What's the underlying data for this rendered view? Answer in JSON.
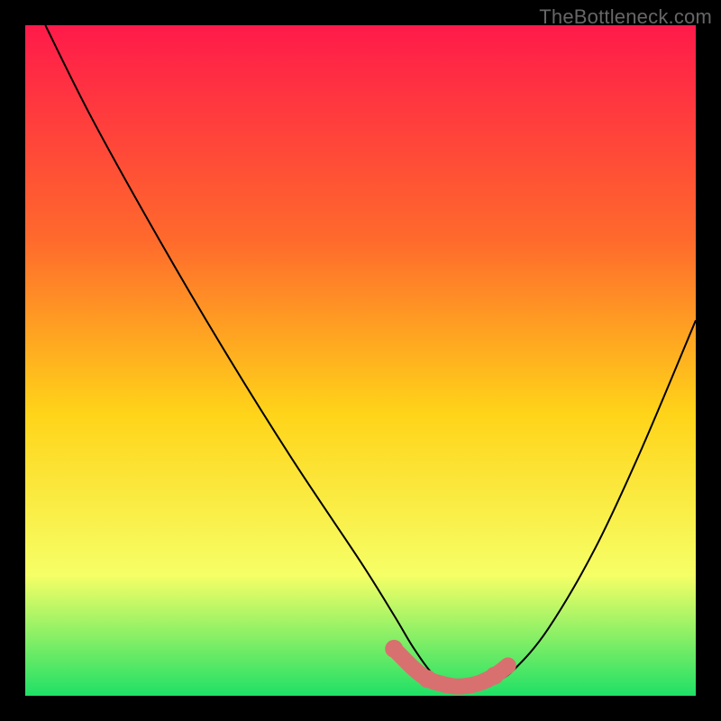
{
  "watermark": "TheBottleneck.com",
  "colors": {
    "background": "#000000",
    "gradient_top": "#ff1a4a",
    "gradient_mid1": "#ff6a2c",
    "gradient_mid2": "#ffd419",
    "gradient_low": "#f6ff66",
    "gradient_bottom": "#1fe066",
    "curve": "#000000",
    "marker_fill": "#d87070",
    "marker_stroke": "#c75f5f"
  },
  "chart_data": {
    "type": "line",
    "title": "",
    "xlabel": "",
    "ylabel": "",
    "xlim": [
      0,
      100
    ],
    "ylim": [
      0,
      100
    ],
    "series": [
      {
        "name": "bottleneck-curve",
        "x": [
          3,
          10,
          20,
          30,
          40,
          50,
          55,
          58,
          61,
          64,
          67,
          70,
          73,
          78,
          85,
          92,
          100
        ],
        "values": [
          100,
          86,
          68,
          51,
          35,
          20,
          12,
          7,
          3,
          1,
          1,
          2,
          4,
          10,
          22,
          37,
          56
        ]
      }
    ],
    "markers": {
      "name": "optimal-range",
      "x": [
        55,
        58,
        60,
        62,
        64,
        66,
        68,
        70,
        72
      ],
      "values": [
        7,
        4,
        2.5,
        1.8,
        1.4,
        1.5,
        2,
        3,
        4.5
      ]
    }
  }
}
